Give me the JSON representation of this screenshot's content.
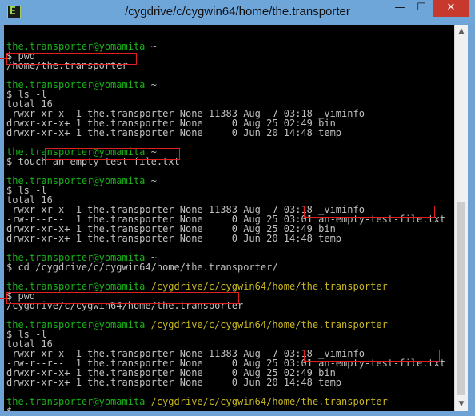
{
  "window": {
    "title": "/cygdrive/c/cygwin64/home/the.transporter",
    "app_icon_glyph": "E",
    "minimize_glyph": "—",
    "maximize_glyph": "☐",
    "close_glyph": "✕"
  },
  "terminal": {
    "colors": {
      "prompt_user": "#18b318",
      "prompt_path": "#c7b720",
      "text": "#c0c0c0",
      "highlight_box": "#e02020"
    },
    "lines": [
      {
        "user": "",
        "path": "",
        "text": ""
      },
      {
        "user": "the.transporter@yomamita",
        "path": "",
        "text": " ~"
      },
      {
        "user": "",
        "path": "",
        "text": "$ pwd"
      },
      {
        "user": "",
        "path": "",
        "text": "/home/the.transporter"
      },
      {
        "user": "",
        "path": "",
        "text": ""
      },
      {
        "user": "the.transporter@yomamita",
        "path": "",
        "text": " ~"
      },
      {
        "user": "",
        "path": "",
        "text": "$ ls -l"
      },
      {
        "user": "",
        "path": "",
        "text": "total 16"
      },
      {
        "user": "",
        "path": "",
        "text": "-rwxr-xr-x  1 the.transporter None 11383 Aug  7 03:18 _viminfo"
      },
      {
        "user": "",
        "path": "",
        "text": "drwxr-xr-x+ 1 the.transporter None     0 Aug 25 02:49 bin"
      },
      {
        "user": "",
        "path": "",
        "text": "drwxr-xr-x+ 1 the.transporter None     0 Jun 20 14:48 temp"
      },
      {
        "user": "",
        "path": "",
        "text": ""
      },
      {
        "user": "the.transporter@yomamita",
        "path": "",
        "text": " ~"
      },
      {
        "user": "",
        "path": "",
        "text": "$ touch an-empty-test-file.txt"
      },
      {
        "user": "",
        "path": "",
        "text": ""
      },
      {
        "user": "the.transporter@yomamita",
        "path": "",
        "text": " ~"
      },
      {
        "user": "",
        "path": "",
        "text": "$ ls -l"
      },
      {
        "user": "",
        "path": "",
        "text": "total 16"
      },
      {
        "user": "",
        "path": "",
        "text": "-rwxr-xr-x  1 the.transporter None 11383 Aug  7 03:18 _viminfo"
      },
      {
        "user": "",
        "path": "",
        "text": "-rw-r--r--  1 the.transporter None     0 Aug 25 03:01 an-empty-test-file.txt"
      },
      {
        "user": "",
        "path": "",
        "text": "drwxr-xr-x+ 1 the.transporter None     0 Aug 25 02:49 bin"
      },
      {
        "user": "",
        "path": "",
        "text": "drwxr-xr-x+ 1 the.transporter None     0 Jun 20 14:48 temp"
      },
      {
        "user": "",
        "path": "",
        "text": ""
      },
      {
        "user": "the.transporter@yomamita",
        "path": "",
        "text": " ~"
      },
      {
        "user": "",
        "path": "",
        "text": "$ cd /cygdrive/c/cygwin64/home/the.transporter/"
      },
      {
        "user": "",
        "path": "",
        "text": ""
      },
      {
        "user": "the.transporter@yomamita",
        "path": " /cygdrive/c/cygwin64/home/the.transporter",
        "text": ""
      },
      {
        "user": "",
        "path": "",
        "text": "$ pwd"
      },
      {
        "user": "",
        "path": "",
        "text": "/cygdrive/c/cygwin64/home/the.transporter"
      },
      {
        "user": "",
        "path": "",
        "text": ""
      },
      {
        "user": "the.transporter@yomamita",
        "path": " /cygdrive/c/cygwin64/home/the.transporter",
        "text": ""
      },
      {
        "user": "",
        "path": "",
        "text": "$ ls -l"
      },
      {
        "user": "",
        "path": "",
        "text": "total 16"
      },
      {
        "user": "",
        "path": "",
        "text": "-rwxr-xr-x  1 the.transporter None 11383 Aug  7 03:18 _viminfo"
      },
      {
        "user": "",
        "path": "",
        "text": "-rw-r--r--  1 the.transporter None     0 Aug 25 03:01 an-empty-test-file.txt"
      },
      {
        "user": "",
        "path": "",
        "text": "drwxr-xr-x+ 1 the.transporter None     0 Aug 25 02:49 bin"
      },
      {
        "user": "",
        "path": "",
        "text": "drwxr-xr-x+ 1 the.transporter None     0 Jun 20 14:48 temp"
      },
      {
        "user": "",
        "path": "",
        "text": ""
      },
      {
        "user": "the.transporter@yomamita",
        "path": " /cygdrive/c/cygwin64/home/the.transporter",
        "text": ""
      },
      {
        "user": "",
        "path": "",
        "text": "$"
      }
    ]
  }
}
